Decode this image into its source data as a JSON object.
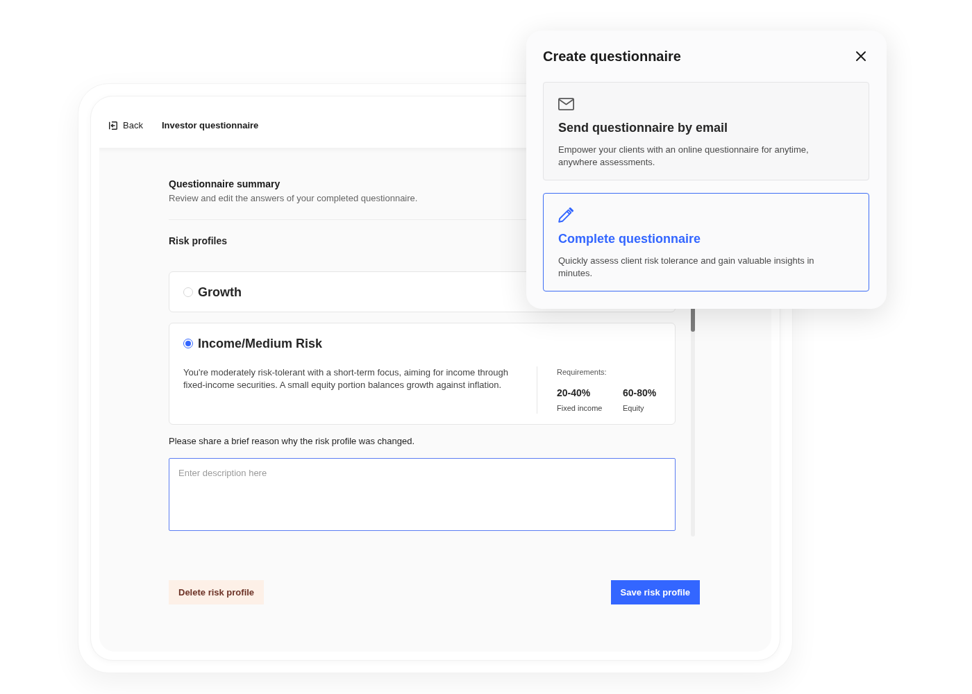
{
  "header": {
    "back_link": "Back",
    "title": "Investor questionnaire"
  },
  "summary": {
    "title": "Questionnaire summary",
    "subtitle": "Review and edit the answers of your completed questionnaire."
  },
  "risk_profiles": {
    "heading": "Risk profiles",
    "options": [
      {
        "label": "Growth",
        "selected": false
      },
      {
        "label": "Income/Medium Risk",
        "selected": true,
        "description": "You're moderately risk-tolerant with a short-term focus, aiming for income through fixed-income securities. A small equity portion balances growth against inflation.",
        "requirements_label": "Requirements:",
        "requirements": [
          {
            "value": "20-40%",
            "label": "Fixed income"
          },
          {
            "value": "60-80%",
            "label": "Equity"
          }
        ]
      }
    ]
  },
  "reason": {
    "label": "Please share a brief reason why the risk profile was changed.",
    "placeholder": "Enter description here"
  },
  "buttons": [
    {
      "label": "Delete risk profile",
      "kind": "danger"
    },
    {
      "label": "Save risk profile",
      "kind": "primary"
    }
  ],
  "dialog": {
    "title": "Create questionnaire",
    "options": [
      {
        "kind": "email",
        "title": "Send questionnaire by email",
        "description": "Empower your clients with an online questionnaire for anytime, anywhere assessments.",
        "selected": false
      },
      {
        "kind": "complete",
        "title": "Complete questionnaire",
        "description": "Quickly assess client risk tolerance and gain valuable insights in minutes.",
        "selected": true
      }
    ]
  }
}
